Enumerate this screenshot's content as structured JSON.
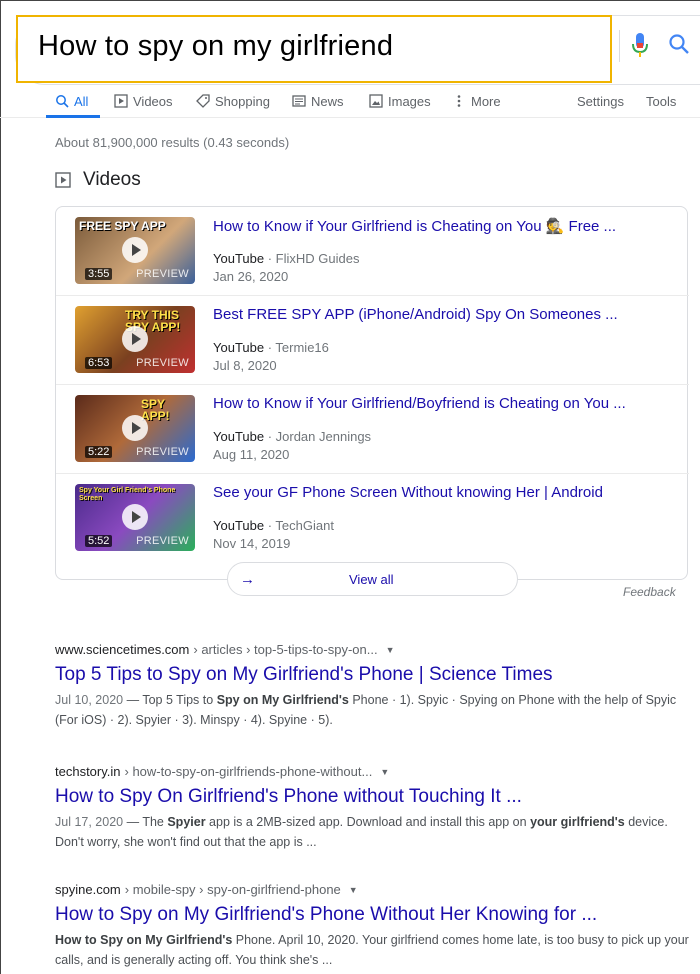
{
  "search": {
    "query": "How to spy on my girlfriend"
  },
  "tabs": [
    {
      "label": "All",
      "icon": "search-icon",
      "active": true
    },
    {
      "label": "Videos",
      "icon": "video-icon"
    },
    {
      "label": "Shopping",
      "icon": "tag-icon"
    },
    {
      "label": "News",
      "icon": "news-icon"
    },
    {
      "label": "Images",
      "icon": "image-icon"
    },
    {
      "label": "More",
      "icon": "more-vertical-icon"
    },
    {
      "label": "Settings"
    },
    {
      "label": "Tools"
    }
  ],
  "result_stats": "About 81,900,000 results (0.43 seconds)",
  "videos_section": {
    "heading": "Videos",
    "items": [
      {
        "title": "How to Know if Your Girlfriend is Cheating on You 🕵️ Free ...",
        "source": "YouTube",
        "channel": " · FlixHD Guides",
        "date": "Jan 26, 2020",
        "duration": "3:55",
        "preview": "PREVIEW",
        "overlay": "FREE SPY APP",
        "thumb_color": "#7a5a3a"
      },
      {
        "title": "Best FREE SPY APP (iPhone/Android) Spy On Someones ...",
        "source": "YouTube",
        "channel": " · Termie16",
        "date": "Jul 8, 2020",
        "duration": "6:53",
        "preview": "PREVIEW",
        "overlay": "TRY THIS SPY APP!",
        "thumb_color": "#c2821f"
      },
      {
        "title": "How to Know if Your Girlfriend/Boyfriend is Cheating on You ...",
        "source": "YouTube",
        "channel": " · Jordan Jennings",
        "date": "Aug 11, 2020",
        "duration": "5:22",
        "preview": "PREVIEW",
        "overlay": "SPY APP!",
        "thumb_color": "#8a4a2a"
      },
      {
        "title": "See your GF Phone Screen Without knowing Her | Android",
        "source": "YouTube",
        "channel": " · TechGiant",
        "date": "Nov 14, 2019",
        "duration": "5:52",
        "preview": "PREVIEW",
        "overlay": "Spy Your Girl Friend's Phone Screen",
        "thumb_color": "#6b3fa0"
      }
    ],
    "view_all": "View all",
    "feedback": "Feedback"
  },
  "results": [
    {
      "site": "www.sciencetimes.com",
      "path": " › articles › top-5-tips-to-spy-on...",
      "title": "Top 5 Tips to Spy on My Girlfriend's Phone | Science Times",
      "date": "Jul 10, 2020",
      "snippet_parts": [
        {
          "t": " — Top 5 Tips to ",
          "b": false
        },
        {
          "t": "Spy on My Girlfriend's",
          "b": true
        },
        {
          "t": " Phone · 1). Spyic · Spying on Phone with the help of Spyic (For iOS) · 2). Spyier · 3). Minspy · 4). Spyine · 5).",
          "b": false
        }
      ]
    },
    {
      "site": "techstory.in",
      "path": " › how-to-spy-on-girlfriends-phone-without...",
      "title": "How to Spy On Girlfriend's Phone without Touching It ...",
      "date": "Jul 17, 2020",
      "snippet_parts": [
        {
          "t": " — The ",
          "b": false
        },
        {
          "t": "Spyier",
          "b": true
        },
        {
          "t": " app is a 2MB-sized app. Download and install this app on ",
          "b": false
        },
        {
          "t": "your girlfriend's",
          "b": true
        },
        {
          "t": " device. Don't worry, she won't find out that the app is ...",
          "b": false
        }
      ]
    },
    {
      "site": "spyine.com",
      "path": " › mobile-spy › spy-on-girlfriend-phone",
      "title": "How to Spy on My Girlfriend's Phone Without Her Knowing for ...",
      "date": "",
      "snippet_parts": [
        {
          "t": "How to Spy on My Girlfriend's",
          "b": true
        },
        {
          "t": " Phone. April 10, 2020. Your girlfriend comes home late, is too busy to pick up your calls, and is generally acting off. You think she's ...",
          "b": false
        }
      ]
    }
  ],
  "colors": {
    "link": "#1a0dab",
    "accent": "#1a73e8",
    "highlight_border": "#f0b400"
  }
}
